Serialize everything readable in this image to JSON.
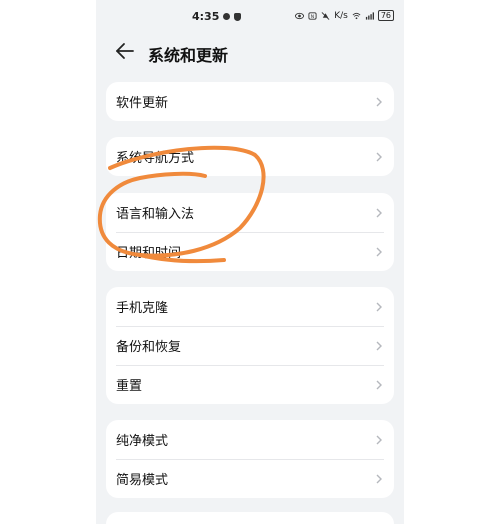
{
  "status_bar": {
    "time": "4:35",
    "network_speed": "K/s",
    "battery": "76"
  },
  "header": {
    "title": "系统和更新"
  },
  "groups": [
    {
      "items": [
        {
          "label": "软件更新"
        }
      ]
    },
    {
      "items": [
        {
          "label": "系统导航方式"
        }
      ]
    },
    {
      "items": [
        {
          "label": "语言和输入法"
        },
        {
          "label": "日期和时间"
        }
      ]
    },
    {
      "items": [
        {
          "label": "手机克隆"
        },
        {
          "label": "备份和恢复"
        },
        {
          "label": "重置"
        }
      ]
    },
    {
      "items": [
        {
          "label": "纯净模式"
        },
        {
          "label": "简易模式"
        }
      ]
    }
  ],
  "colors": {
    "annotation_stroke": "#f08a3c",
    "background": "#f1f3f5",
    "card": "#ffffff"
  }
}
